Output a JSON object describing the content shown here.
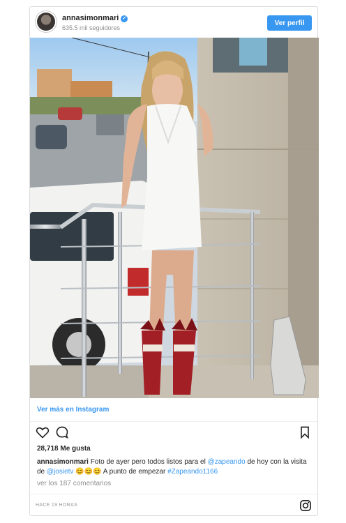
{
  "post": {
    "username": "annasimonmari",
    "verified_glyph": "✓",
    "followers": "635.5 mil seguidores",
    "profile_button": "Ver perfil",
    "more_link": "Ver más en Instagram",
    "likes": "28,718 Me gusta",
    "caption": {
      "author": "annasimonmari",
      "text1": " Foto de ayer pero todos listos para el ",
      "mention1": "@zapeando",
      "text2": " de hoy con la visita de ",
      "mention2": "@josietv",
      "emojis": " 😊😊😊 ",
      "text3": " A punto de empezar ",
      "hashtag": "#Zapeando1166"
    },
    "comments": "ver los 187 comentarios",
    "time": "HACE 19 HORAS"
  },
  "icons": {
    "like": "heart-icon",
    "comment": "comment-icon",
    "save": "bookmark-icon",
    "brand": "instagram-icon"
  },
  "colors": {
    "accent": "#3897f0",
    "text": "#262626",
    "muted": "#8e8e8e",
    "border": "#dbdbdb"
  }
}
